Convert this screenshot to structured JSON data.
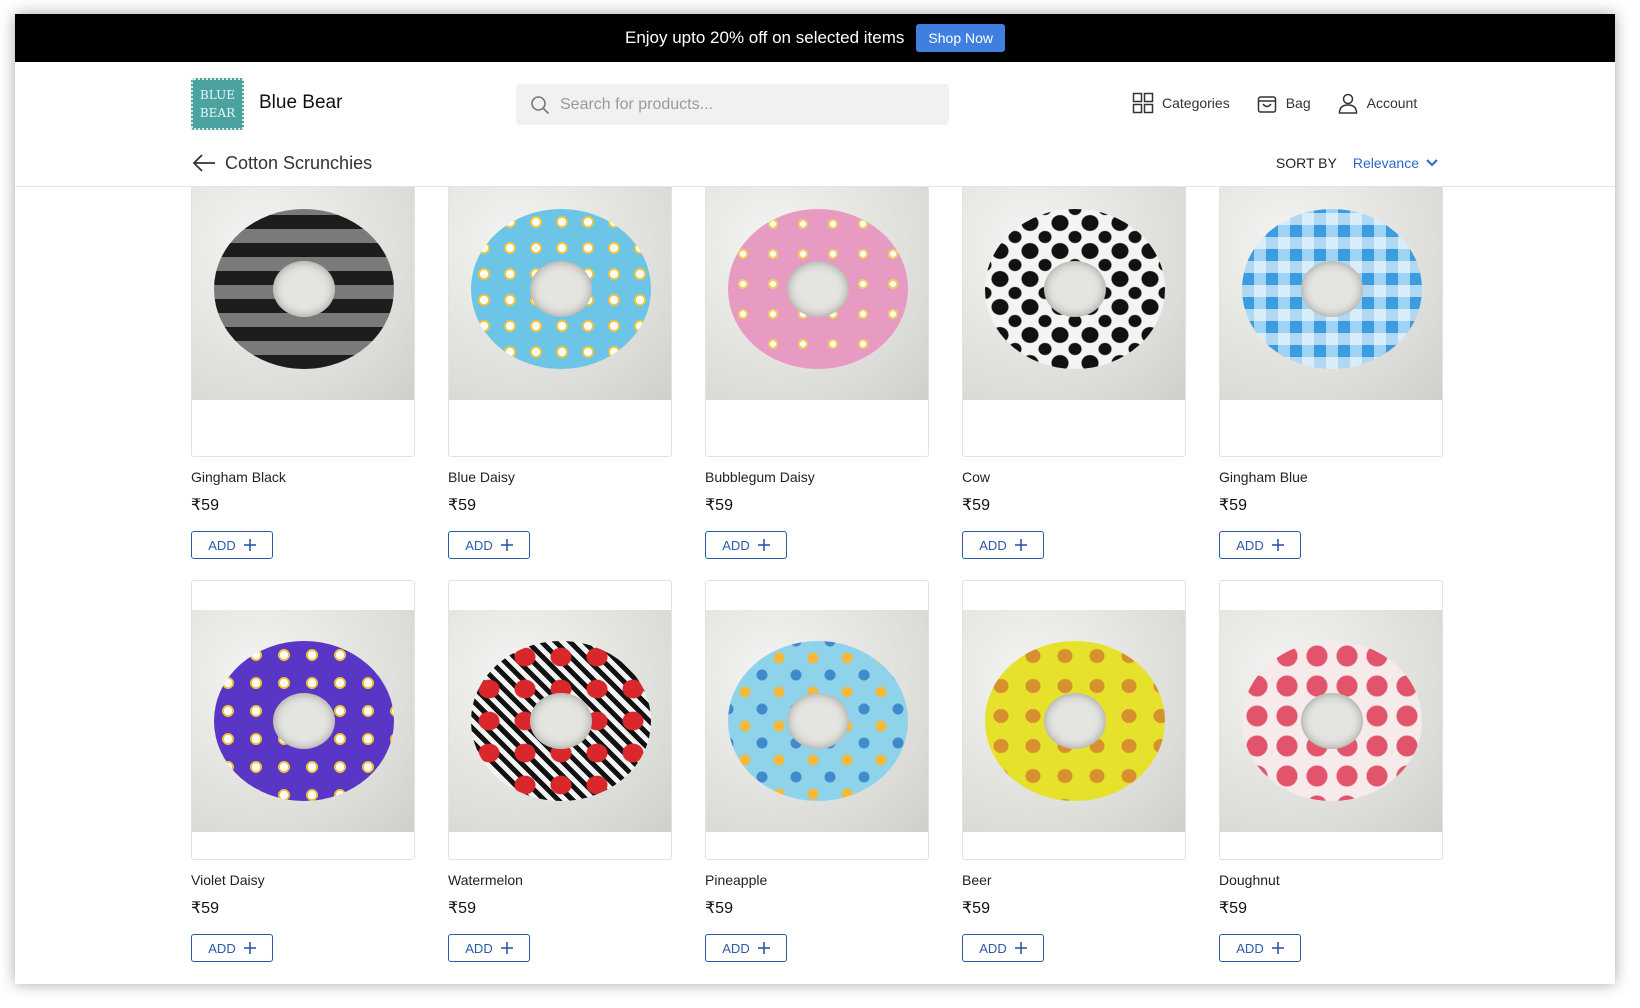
{
  "promo": {
    "text": "Enjoy upto 20% off on selected items",
    "button": "Shop Now"
  },
  "header": {
    "logo_line1": "BLUE",
    "logo_line2": "BEAR",
    "brand": "Blue Bear",
    "search_placeholder": "Search for products...",
    "nav": {
      "categories": "Categories",
      "bag": "Bag",
      "account": "Account"
    }
  },
  "subheader": {
    "title": "Cotton Scrunchies",
    "sort_label": "SORT BY",
    "sort_value": "Relevance"
  },
  "products": [
    {
      "name": "Gingham Black",
      "price": "₹59",
      "add": "ADD"
    },
    {
      "name": "Blue Daisy",
      "price": "₹59",
      "add": "ADD"
    },
    {
      "name": "Bubblegum Daisy",
      "price": "₹59",
      "add": "ADD"
    },
    {
      "name": "Cow",
      "price": "₹59",
      "add": "ADD"
    },
    {
      "name": "Gingham Blue",
      "price": "₹59",
      "add": "ADD"
    },
    {
      "name": "Violet Daisy",
      "price": "₹59",
      "add": "ADD"
    },
    {
      "name": "Watermelon",
      "price": "₹59",
      "add": "ADD"
    },
    {
      "name": "Pineapple",
      "price": "₹59",
      "add": "ADD"
    },
    {
      "name": "Beer",
      "price": "₹59",
      "add": "ADD"
    },
    {
      "name": "Doughnut",
      "price": "₹59",
      "add": "ADD"
    }
  ],
  "colors": {
    "accent": "#2b67c6",
    "promo_button": "#3f7fe0",
    "logo_bg": "#4aa39f"
  }
}
